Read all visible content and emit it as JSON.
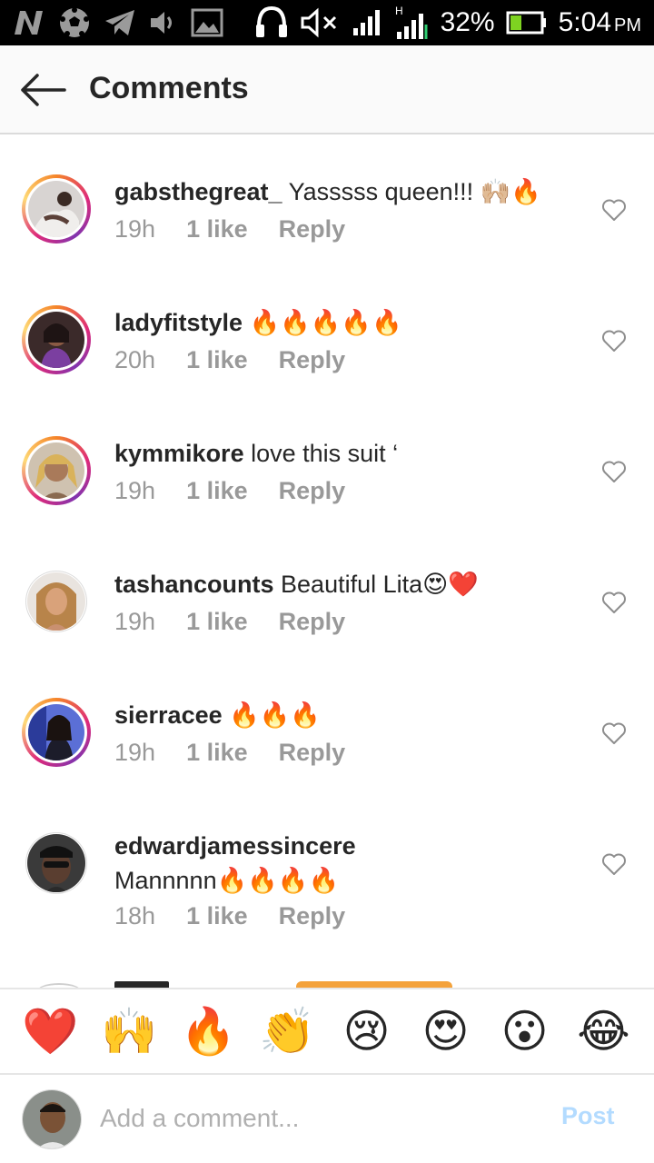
{
  "status_bar": {
    "battery": "32%",
    "time": "5:04",
    "ampm": "PM",
    "icons": [
      "n-logo-icon",
      "soccer-ball-icon",
      "telegram-icon",
      "volume-icon",
      "image-icon",
      "headset-icon",
      "mute-icon",
      "signal-icon",
      "h-signal-icon",
      "battery-icon"
    ]
  },
  "header": {
    "title": "Comments",
    "back_icon": "back-arrow-icon"
  },
  "comments": [
    {
      "username": "gabsthegreat_",
      "text": " Yasssss queen!!! 🙌🏼🔥",
      "time": "19h",
      "likes": "1 like",
      "reply": "Reply",
      "ring": true
    },
    {
      "username": "ladyfitstyle",
      "text": " 🔥🔥🔥🔥🔥",
      "time": "20h",
      "likes": "1 like",
      "reply": "Reply",
      "ring": true
    },
    {
      "username": "kymmikore",
      "text": " love this suit ‘",
      "time": "19h",
      "likes": "1 like",
      "reply": "Reply",
      "ring": true
    },
    {
      "username": "tashancounts",
      "text": " Beautiful Lita😍❤️",
      "time": "19h",
      "likes": "1 like",
      "reply": "Reply",
      "ring": false
    },
    {
      "username": "sierracee",
      "text": " 🔥🔥🔥",
      "time": "19h",
      "likes": "1 like",
      "reply": "Reply",
      "ring": true
    },
    {
      "username": "edwardjamessincere",
      "text": "Mannnnn🔥🔥🔥🔥",
      "time": "18h",
      "likes": "1 like",
      "reply": "Reply",
      "ring": false
    }
  ],
  "emoji_bar": [
    "❤️",
    "🙌",
    "🔥",
    "👏",
    "😢",
    "😍",
    "😮",
    "😂"
  ],
  "composer": {
    "placeholder": "Add a comment...",
    "post_label": "Post"
  },
  "colors": {
    "text": "#262626",
    "meta": "#999999",
    "post_disabled": "#b3dbff",
    "header_bg": "#fafafa"
  }
}
